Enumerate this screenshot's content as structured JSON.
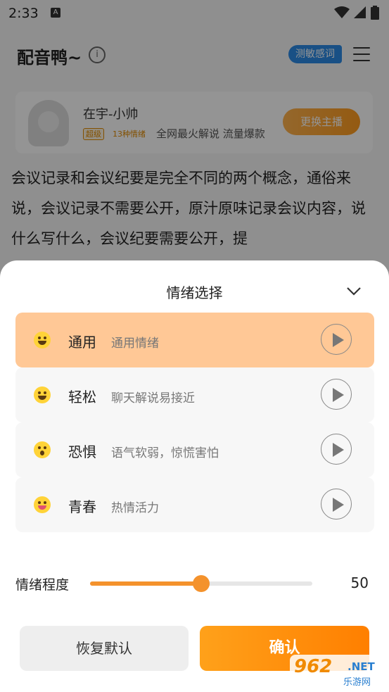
{
  "status_bar": {
    "time": "2:33",
    "notification_icon": "A"
  },
  "header": {
    "title": "配音鸭~",
    "sensitive_btn": "测敏感词"
  },
  "voice": {
    "name": "在宇-小帅",
    "level_badge": "超级",
    "emotion_badge": "13种情绪",
    "desc": "全网最火解说 流量爆款",
    "switch_label": "更换主播"
  },
  "article": {
    "text": "会议记录和会议纪要是完全不同的两个概念，通俗来说，会议记录不需要公开，原汁原味记录会议内容，说什么写什么，会议纪要需要公开，提"
  },
  "sheet": {
    "title": "情绪选择",
    "emotions": [
      {
        "name": "通用",
        "desc": "通用情绪",
        "selected": true
      },
      {
        "name": "轻松",
        "desc": "聊天解说易接近"
      },
      {
        "name": "恐惧",
        "desc": "语气软弱，惊慌害怕"
      },
      {
        "name": "青春",
        "desc": "热情活力"
      }
    ],
    "level_label": "情绪程度",
    "level_value": "50",
    "level_fraction": 0.5,
    "reset_label": "恢复默认",
    "confirm_label": "确认"
  },
  "watermark": {
    "number": "962",
    "net": ".NET",
    "sub": "乐游网"
  },
  "colors": {
    "accent": "#f4922c",
    "selected": "#ffc896",
    "blue": "#2b8be6"
  }
}
